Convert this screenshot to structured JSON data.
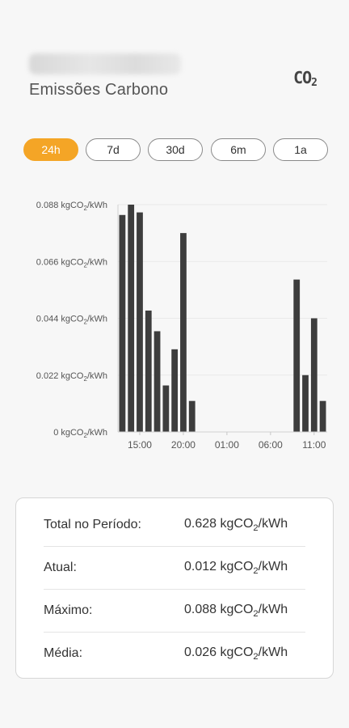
{
  "header": {
    "subtitle": "Emissões Carbono",
    "co2_icon_main": "CO",
    "co2_icon_sub": "2"
  },
  "tabs": [
    {
      "label": "24h",
      "active": true
    },
    {
      "label": "7d",
      "active": false
    },
    {
      "label": "30d",
      "active": false
    },
    {
      "label": "6m",
      "active": false
    },
    {
      "label": "1a",
      "active": false
    }
  ],
  "chart_data": {
    "type": "bar",
    "unit_prefix": "kgCO",
    "unit_sub": "2",
    "unit_suffix": "/kWh",
    "yticks": [
      0,
      0.022,
      0.044,
      0.066,
      0.088
    ],
    "ylim": [
      0,
      0.088
    ],
    "xticks": [
      "15:00",
      "20:00",
      "01:00",
      "06:00",
      "11:00"
    ],
    "bar_color": "#3d3d3d",
    "grid": true,
    "values": [
      0.084,
      0.088,
      0.085,
      0.047,
      0.039,
      0.018,
      0.032,
      0.077,
      0.012,
      0,
      0,
      0,
      0,
      0,
      0,
      0,
      0,
      0,
      0,
      0,
      0.059,
      0.022,
      0.044,
      0.012
    ]
  },
  "stats": [
    {
      "label": "Total no Período:",
      "value": "0.628",
      "unit": "kgCO",
      "unit_sub": "2",
      "unit_suffix": "/kWh"
    },
    {
      "label": "Atual:",
      "value": "0.012",
      "unit": "kgCO",
      "unit_sub": "2",
      "unit_suffix": "/kWh"
    },
    {
      "label": "Máximo:",
      "value": "0.088",
      "unit": "kgCO",
      "unit_sub": "2",
      "unit_suffix": "/kWh"
    },
    {
      "label": "Média:",
      "value": "0.026",
      "unit": "kgCO",
      "unit_sub": "2",
      "unit_suffix": "/kWh"
    }
  ],
  "colors": {
    "accent": "#f4a526",
    "bar": "#3d3d3d"
  }
}
